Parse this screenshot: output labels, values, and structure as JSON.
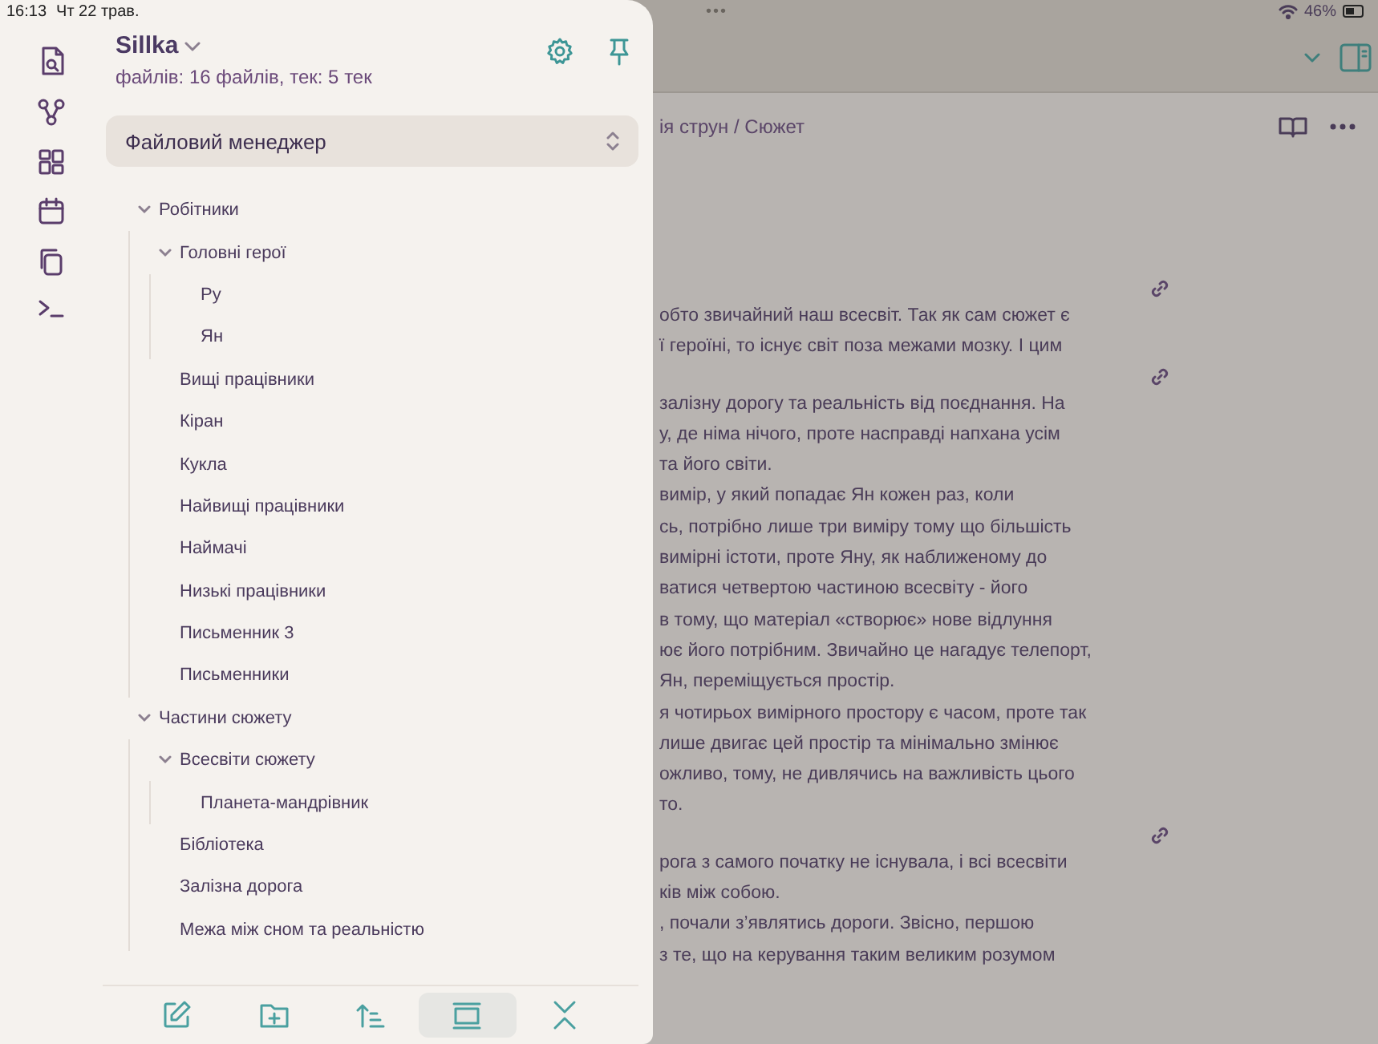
{
  "status_bar": {
    "time": "16:13",
    "date": "Чт 22 трав.",
    "multitask": "•••",
    "battery": "46%"
  },
  "panel": {
    "vault": "Sillka",
    "stats": "файлів: 16 файлів, тек: 5 тек",
    "view_selector": "Файловий менеджер",
    "tree": [
      {
        "label": "Робітники",
        "expanded": true,
        "children": [
          {
            "label": "Головні герої",
            "expanded": true,
            "children": [
              {
                "label": "Ру"
              },
              {
                "label": "Ян"
              }
            ]
          },
          {
            "label": "Вищі працівники"
          },
          {
            "label": "Кіран"
          },
          {
            "label": "Кукла"
          },
          {
            "label": "Найвищі працівники"
          },
          {
            "label": "Наймачі"
          },
          {
            "label": "Низькі працівники"
          },
          {
            "label": "Письменник 3"
          },
          {
            "label": "Письменники"
          }
        ]
      },
      {
        "label": "Частини сюжету",
        "expanded": true,
        "children": [
          {
            "label": "Всесвіти сюжету",
            "expanded": true,
            "children": [
              {
                "label": "Планета-мандрівник"
              }
            ]
          },
          {
            "label": "Бібліотека"
          },
          {
            "label": "Залізна дорога"
          },
          {
            "label": "Межа між сном та реальністю"
          }
        ]
      }
    ],
    "toolbar": [
      {
        "kind": "new-note",
        "selected": false
      },
      {
        "kind": "new-folder",
        "selected": false
      },
      {
        "kind": "sort",
        "selected": false
      },
      {
        "kind": "view",
        "selected": true
      },
      {
        "kind": "collapse",
        "selected": false
      }
    ]
  },
  "note": {
    "breadcrumb": "ія струн / Сюжет",
    "sections": [
      {
        "lines": [
          "обто звичайний наш всесвіт. Так як сам сюжет є",
          "ї героїні, то існує світ поза межами мозку. І цим"
        ]
      },
      {
        "lines": [
          "залізну дорогу та реальність від поєднання. На",
          "у, де німа нічого, проте насправді напхана усім",
          "та його світи.",
          "вимір, у який попадає Ян кожен раз, коли",
          "сь, потрібно лише три виміру тому що більшість",
          "вимірні істоти, проте Яну, як наближеному до",
          "ватися четвертою частиною всесвіту - його",
          "в тому, що матеріал «створює» нове відлуння",
          "ює його потрібним. Звичайно це нагадує телепорт,",
          "Ян, переміщується простір.",
          "я чотирьох вимірного простору є часом, проте так",
          "лише двигає цей простір та мінімально змінює",
          "ожливо, тому, не дивлячись на важливість цього",
          "то."
        ]
      },
      {
        "lines": [
          "рога з самого початку не існувала, і всі всесвіти",
          "ків між собою.",
          ", почали з’являтись дороги. Звісно, першою",
          "з те, що на керування таким великим розумом"
        ]
      }
    ]
  }
}
